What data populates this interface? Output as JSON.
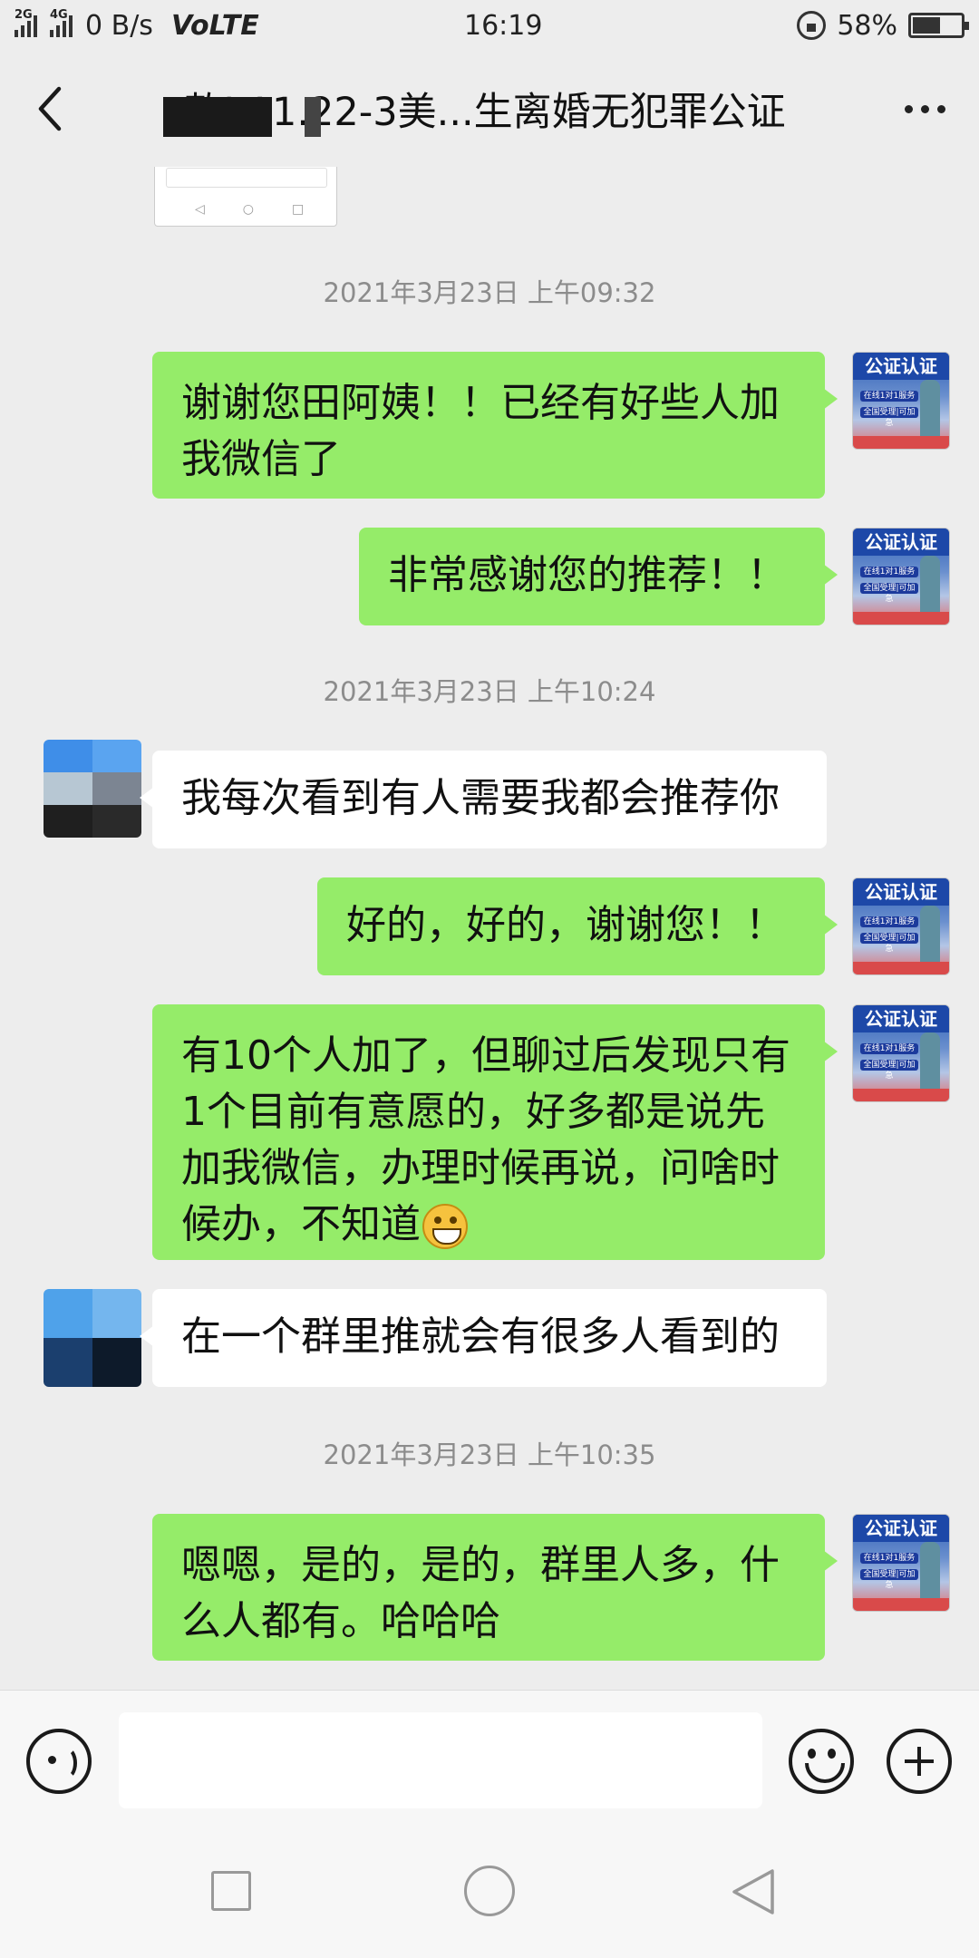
{
  "status_bar": {
    "signal_1": "2G",
    "signal_2": "4G",
    "net_speed": "0 B/s",
    "volte": "VoLTE",
    "time": "16:19",
    "battery_percent": "58%",
    "battery_level": 0.58
  },
  "header": {
    "title": "款Ⅰ     11.22-3美...生离婚无犯罪公证"
  },
  "chat": {
    "messages": [
      {
        "type": "time",
        "text": "2021年3月23日 上午09:32"
      },
      {
        "type": "out",
        "text": "谢谢您田阿姨！！已经有好些人加\n我微信了"
      },
      {
        "type": "out",
        "text": "非常感谢您的推荐！！"
      },
      {
        "type": "time",
        "text": "2021年3月23日 上午10:24"
      },
      {
        "type": "in",
        "text": "我每次看到有人需要我都会推荐你"
      },
      {
        "type": "out",
        "text": "好的，好的，谢谢您！！"
      },
      {
        "type": "out",
        "text": "有10个人加了，但聊过后发现只有\n1个目前有意愿的，好多都是说先\n加我微信，办理时候再说，问啥时\n候办，不知道",
        "emoji": "grinning-face"
      },
      {
        "type": "in",
        "text": "在一个群里推就会有很多人看到的"
      },
      {
        "type": "time",
        "text": "2021年3月23日 上午10:35"
      },
      {
        "type": "out",
        "text": "嗯嗯，是的，是的，群里人多，什\n么人都有。哈哈哈"
      }
    ],
    "self_avatar": {
      "title": "公证认证",
      "row1": "在线1对1服务",
      "row2": "全国受理|可加急"
    }
  },
  "input": {
    "value": "",
    "placeholder": ""
  },
  "colors": {
    "bubble_out": "#95ec69",
    "bubble_in": "#ffffff",
    "background": "#ededed"
  }
}
